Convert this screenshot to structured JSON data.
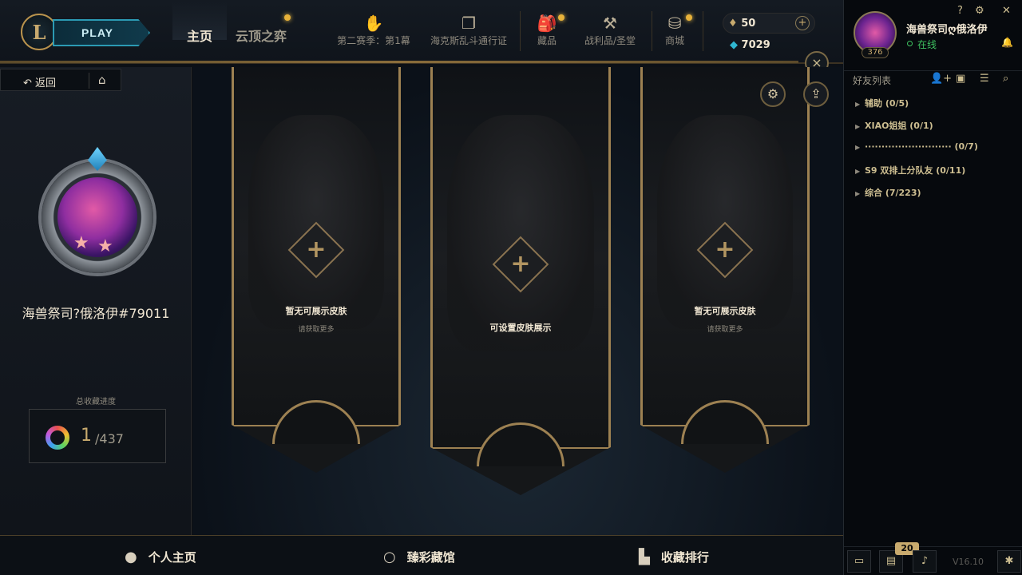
{
  "topbar": {
    "logo": "L",
    "play_label": "PLAY",
    "tabs": [
      {
        "label": "主页"
      },
      {
        "label": "云顶之弈"
      }
    ],
    "nav": [
      {
        "label": "第二赛季：第1幕",
        "icon": "rune-icon"
      },
      {
        "label": "海克斯乱斗通行证",
        "icon": "cards-icon"
      },
      {
        "label": "藏品",
        "icon": "backpack-icon"
      },
      {
        "label": "战利品/圣堂",
        "icon": "hammer-icon"
      },
      {
        "label": "商城",
        "icon": "coins-icon"
      }
    ],
    "rp": "50",
    "rp_add": "+",
    "blue_essence": "7029",
    "close": "×"
  },
  "left_panel": {
    "back_label": "返回",
    "home_icon": "⌂",
    "summoner_name": "海兽祭司?俄洛伊#79011",
    "collection_label": "总收藏进度",
    "collection_count": "1",
    "collection_total": "/437"
  },
  "banners": [
    {
      "title": "暂无可展示皮肤",
      "subtitle": "请获取更多"
    },
    {
      "title": "可设置皮肤展示",
      "subtitle": ""
    },
    {
      "title": "暂无可展示皮肤",
      "subtitle": "请获取更多"
    }
  ],
  "center": {
    "settings_icon": "⚙",
    "share_icon": "⇪"
  },
  "bottombar": {
    "items": [
      {
        "label": "个人主页",
        "icon": "profile-icon"
      },
      {
        "label": "臻彩藏馆",
        "icon": "ring-icon"
      },
      {
        "label": "收藏排行",
        "icon": "ranking-icon"
      }
    ]
  },
  "sidebar": {
    "name": "海兽祭司ღ俄洛伊",
    "status": "在线",
    "level": "376",
    "window": {
      "help": "?",
      "settings": "⚙",
      "close": "✕"
    },
    "friends_title": "好友列表",
    "groups": [
      {
        "label": "辅助 (0/5)"
      },
      {
        "label": "XIAO姐姐 (0/1)"
      },
      {
        "label": "·························· (0/7)"
      },
      {
        "label": "S9 双排上分队友 (0/11)"
      },
      {
        "label": "综合 (7/223)"
      }
    ],
    "badge": "20",
    "version": "V16.10"
  },
  "colors": {
    "gold": "#c8aa6e",
    "play_border": "#2b9ab3",
    "online": "#3ec160",
    "badge": "#c8aa6e"
  }
}
